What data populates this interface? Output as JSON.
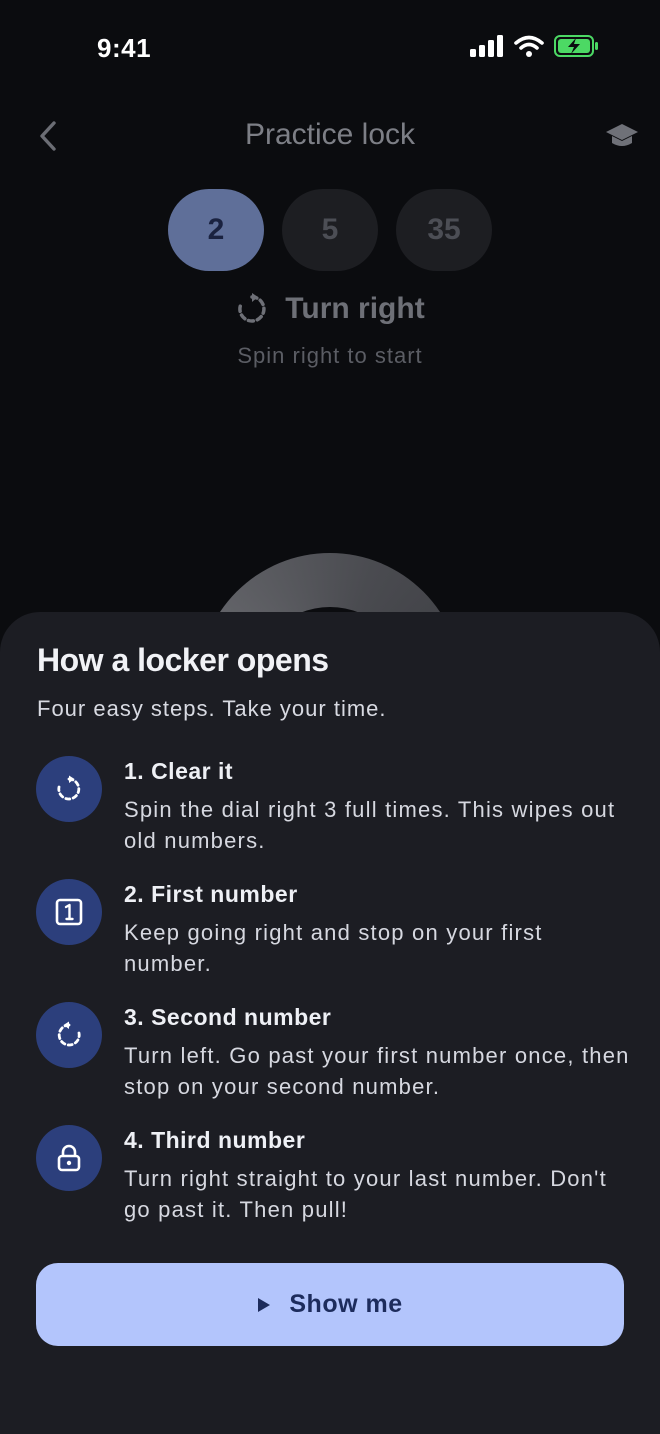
{
  "status_bar": {
    "time": "9:41"
  },
  "header": {
    "title": "Practice lock"
  },
  "combination": [
    {
      "value": "2",
      "active": true
    },
    {
      "value": "5",
      "active": false
    },
    {
      "value": "35",
      "active": false
    }
  ],
  "instruction": {
    "label": "Turn right",
    "hint": "Spin right to start"
  },
  "sheet": {
    "title": "How a locker opens",
    "subtitle": "Four easy steps. Take your time.",
    "steps": [
      {
        "title": "1. Clear it",
        "description": "Spin the dial right 3 full times. This wipes out old numbers.",
        "icon": "rotate-right-icon"
      },
      {
        "title": "2. First number",
        "description": "Keep going right and stop on your first number.",
        "icon": "number-one-icon"
      },
      {
        "title": "3. Second number",
        "description": "Turn left. Go past your first number once, then stop on your second number.",
        "icon": "rotate-left-icon"
      },
      {
        "title": "4. Third number",
        "description": "Turn right straight to your last number. Don't go past it. Then pull!",
        "icon": "lock-icon"
      }
    ],
    "button_label": "Show me"
  },
  "colors": {
    "accent": "#b3c5fc",
    "step_icon_bg": "#2c3f7c",
    "sheet_bg": "#1c1d23",
    "battery": "#4cd964"
  }
}
